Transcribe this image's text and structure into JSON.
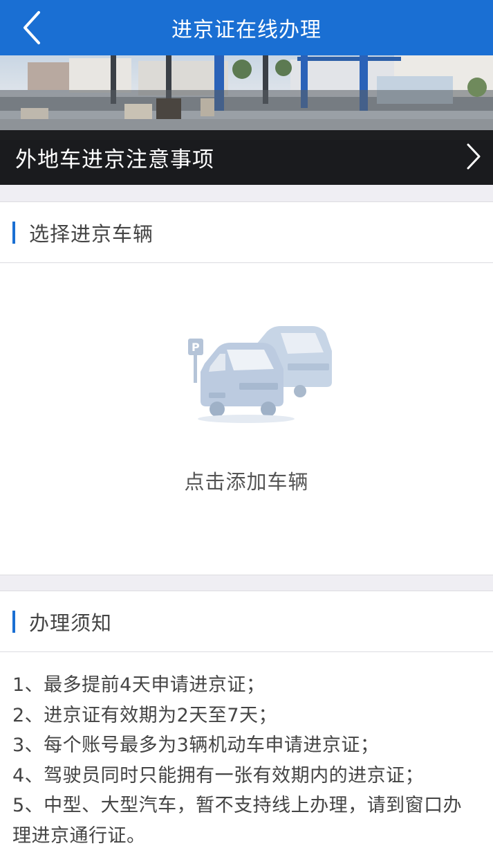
{
  "header": {
    "title": "进京证在线办理"
  },
  "banner": {
    "caption": "外地车进京注意事项"
  },
  "vehicle_section": {
    "title": "选择进京车辆",
    "add_text": "点击添加车辆"
  },
  "notice_section": {
    "title": "办理须知",
    "items": [
      "1、最多提前4天申请进京证；",
      "2、进京证有效期为2天至7天；",
      "3、每个账号最多为3辆机动车申请进京证；",
      "4、驾驶员同时只能拥有一张有效期内的进京证；",
      "5、中型、大型汽车，暂不支持线上办理，请到窗口办理进京通行证。"
    ]
  },
  "colors": {
    "accent": "#1a6fd3",
    "background": "#efeef3"
  }
}
